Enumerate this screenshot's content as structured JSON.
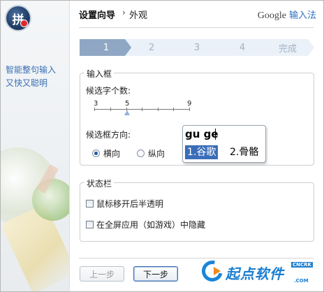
{
  "header": {
    "title": "设置向导",
    "separator": "›",
    "breadcrumb": "外观",
    "brand_google": "Google",
    "brand_product": "输入法"
  },
  "sidebar": {
    "tagline_line1": "智能整句输入",
    "tagline_line2": "又快又聪明",
    "logo_char": "拼"
  },
  "steps": [
    {
      "label": "1",
      "active": true
    },
    {
      "label": "2",
      "active": false
    },
    {
      "label": "3",
      "active": false
    },
    {
      "label": "4",
      "active": false
    },
    {
      "label": "完成",
      "active": false
    }
  ],
  "candidate_box": {
    "group_title": "输入框",
    "count_label": "候选字个数:",
    "slider_ticks": [
      "3",
      "5",
      "9"
    ],
    "slider_value": 5,
    "direction_label": "候选框方向:",
    "options": [
      "横向",
      "纵向"
    ],
    "selected_option": "横向",
    "preview_input": "gu ge",
    "preview_selected": "1.谷歌",
    "preview_alt": "2.骨骼"
  },
  "status_bar": {
    "group_title": "状态栏",
    "option1": "鼠标移开后半透明",
    "option1_checked": false,
    "option2": "在全屏应用（如游戏）中隐藏",
    "option2_checked": false
  },
  "buttons": {
    "prev": "上一步",
    "next": "下一步"
  },
  "watermark": {
    "text": "起点软件",
    "tag": "CNCRK",
    "sub": ".COM"
  },
  "colors": {
    "accent_blue": "#3a6db8",
    "step_active": "#8fa7c4",
    "step_inactive": "#eaf1f8",
    "link_blue": "#3a6fb4"
  }
}
